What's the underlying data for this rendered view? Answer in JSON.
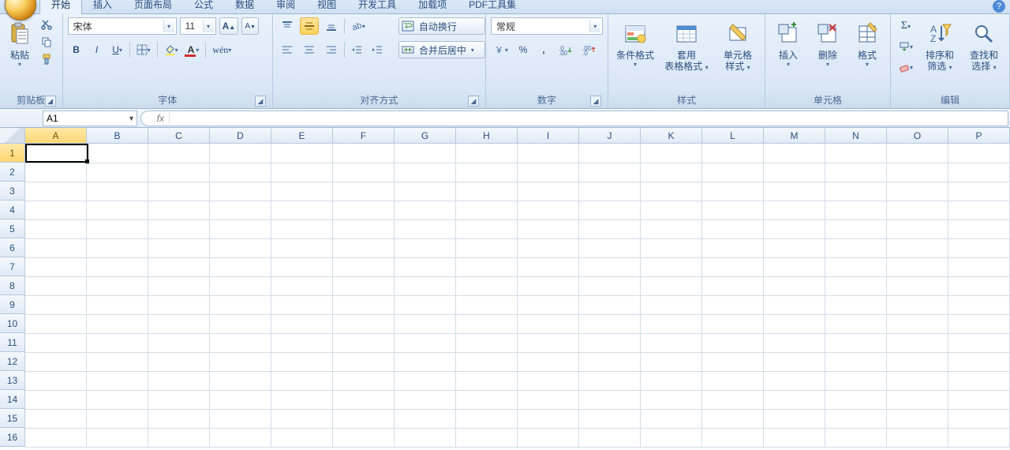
{
  "tabs": {
    "items": [
      "开始",
      "插入",
      "页面布局",
      "公式",
      "数据",
      "审阅",
      "视图",
      "开发工具",
      "加载项",
      "PDF工具集"
    ],
    "active_index": 0
  },
  "ribbon": {
    "clipboard": {
      "paste": "粘贴",
      "label": "剪贴板"
    },
    "font": {
      "fontname": "宋体",
      "fontsize": "11",
      "label": "字体"
    },
    "align": {
      "wrap": "自动换行",
      "merge": "合并后居中",
      "label": "对齐方式"
    },
    "number": {
      "format": "常规",
      "percent": "%",
      "comma": ",",
      "label": "数字"
    },
    "styles": {
      "cond": "条件格式",
      "tablefmt1": "套用",
      "tablefmt2": "表格格式",
      "cell1": "单元格",
      "cell2": "样式",
      "label": "样式"
    },
    "cells": {
      "insert": "插入",
      "delete": "删除",
      "format": "格式",
      "label": "单元格"
    },
    "editing": {
      "sort1": "排序和",
      "sort2": "筛选",
      "find1": "查找和",
      "find2": "选择",
      "label": "编辑"
    }
  },
  "namebox": {
    "cell": "A1"
  },
  "grid": {
    "columns": [
      "A",
      "B",
      "C",
      "D",
      "E",
      "F",
      "G",
      "H",
      "I",
      "J",
      "K",
      "L",
      "M",
      "N",
      "O",
      "P"
    ],
    "rows": [
      "1",
      "2",
      "3",
      "4",
      "5",
      "6",
      "7",
      "8",
      "9",
      "10",
      "11",
      "12",
      "13",
      "14",
      "15",
      "16"
    ]
  }
}
